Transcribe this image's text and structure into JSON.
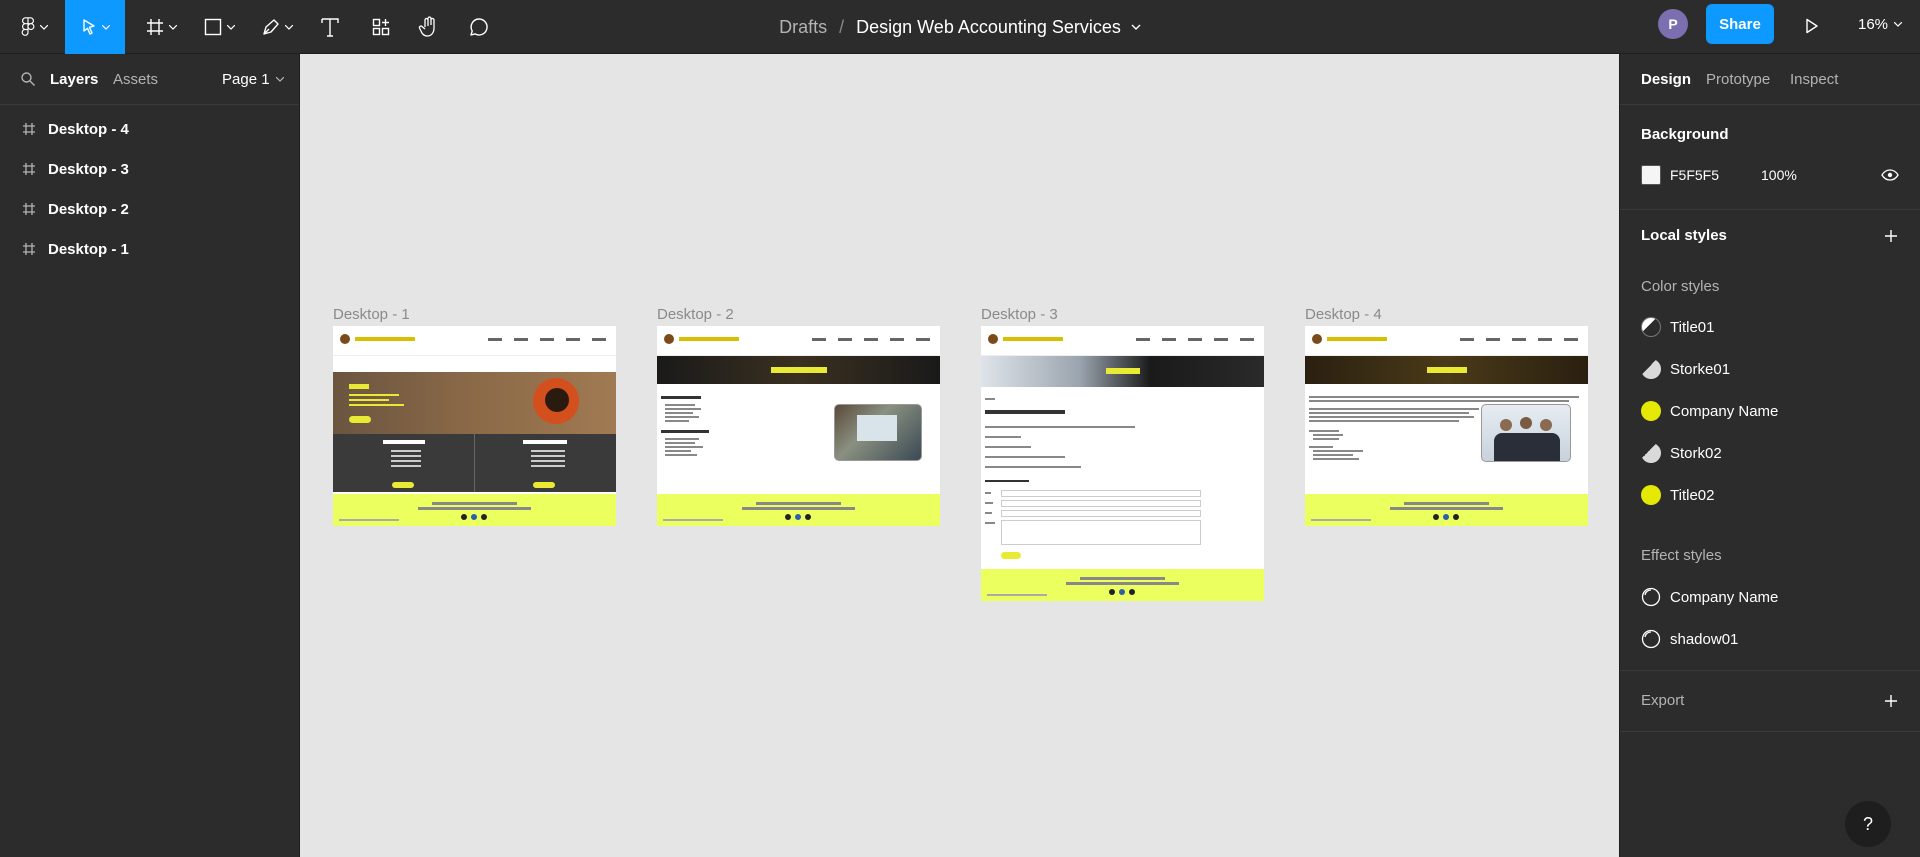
{
  "toolbar": {
    "tools": [
      "main-menu",
      "move",
      "frame",
      "shape",
      "pen",
      "text",
      "resources",
      "hand",
      "comment"
    ],
    "breadcrumb": "Drafts",
    "file_name": "Design Web Accounting Services",
    "avatar_initial": "P",
    "share_label": "Share",
    "zoom": "16%"
  },
  "left_panel": {
    "tabs": {
      "layers": "Layers",
      "assets": "Assets"
    },
    "page": "Page 1",
    "layers": [
      "Desktop - 4",
      "Desktop - 3",
      "Desktop - 2",
      "Desktop - 1"
    ]
  },
  "canvas": {
    "frames": [
      {
        "label": "Desktop - 1"
      },
      {
        "label": "Desktop - 2"
      },
      {
        "label": "Desktop - 3"
      },
      {
        "label": "Desktop - 4"
      }
    ]
  },
  "right_panel": {
    "tabs": {
      "design": "Design",
      "prototype": "Prototype",
      "inspect": "Inspect"
    },
    "background": {
      "title": "Background",
      "hex": "F5F5F5",
      "opacity": "100%",
      "color": "#F5F5F5"
    },
    "local_styles": "Local styles",
    "color_styles": {
      "title": "Color styles",
      "items": [
        {
          "name": "Title01",
          "color": "#2b2b2b"
        },
        {
          "name": "Storke01",
          "color": "#d9d9d9"
        },
        {
          "name": "Company Name",
          "color": "#e5e800"
        },
        {
          "name": "Stork02",
          "color": "#d9d9d9"
        },
        {
          "name": "Title02",
          "color": "#e5e800"
        }
      ]
    },
    "effect_styles": {
      "title": "Effect styles",
      "items": [
        "Company Name",
        "shadow01"
      ]
    },
    "export": "Export",
    "help": "?"
  }
}
